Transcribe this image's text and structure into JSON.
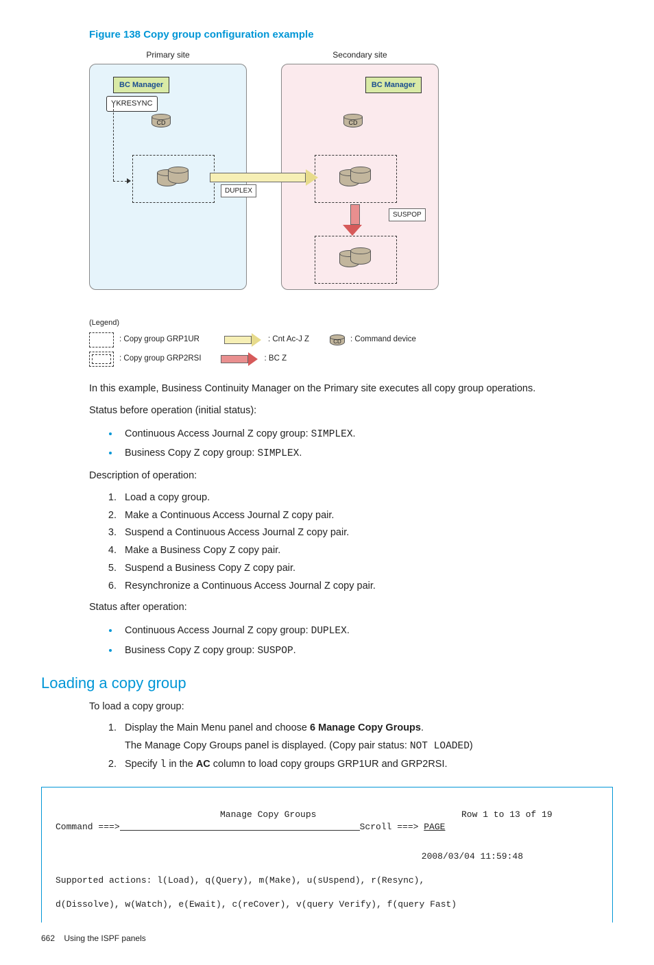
{
  "figure": {
    "title": "Figure 138 Copy group configuration example",
    "primary_label": "Primary site",
    "secondary_label": "Secondary site",
    "bc_manager": "BC Manager",
    "ykresync": "YKRESYNC",
    "cd": "CD",
    "duplex": "DUPLEX",
    "suspop": "SUSPOP",
    "legend_title": "(Legend)",
    "legend_grp1": ": Copy group GRP1UR",
    "legend_grp2": ": Copy group GRP2RSI",
    "legend_cntacj": ": Cnt Ac-J Z",
    "legend_bcz": ": BC Z",
    "legend_cmddev": ": Command device"
  },
  "body": {
    "intro": "In this example, Business Continuity Manager on the Primary site executes all copy group operations.",
    "status_before_label": "Status before operation (initial status):",
    "status_before": [
      {
        "text": "Continuous Access Journal Z copy group: ",
        "code": "SIMPLEX",
        "suffix": "."
      },
      {
        "text": "Business Copy Z copy group: ",
        "code": "SIMPLEX",
        "suffix": "."
      }
    ],
    "desc_label": "Description of operation:",
    "steps": [
      "Load a copy group.",
      "Make a Continuous Access Journal Z copy pair.",
      "Suspend a Continuous Access Journal Z copy pair.",
      "Make a Business Copy Z copy pair.",
      "Suspend a Business Copy Z copy pair.",
      "Resynchronize a Continuous Access Journal Z copy pair."
    ],
    "status_after_label": "Status after operation:",
    "status_after": [
      {
        "text": "Continuous Access Journal Z copy group: ",
        "code": "DUPLEX",
        "suffix": "."
      },
      {
        "text": "Business Copy Z copy group: ",
        "code": "SUSPOP",
        "suffix": "."
      }
    ]
  },
  "section2": {
    "heading": "Loading a copy group",
    "lead": "To load a copy group:",
    "step1_a": "Display the Main Menu panel and choose ",
    "step1_b_bold": "6 Manage Copy Groups",
    "step1_c": ".",
    "step1_sub_a": "The Manage Copy Groups panel is displayed. (Copy pair status: ",
    "step1_sub_code": "NOT LOADED",
    "step1_sub_b": ")",
    "step2_a": "Specify ",
    "step2_code": "l",
    "step2_b": " in the ",
    "step2_bold": "AC",
    "step2_c": " column to load copy groups GRP1UR and GRP2RSI."
  },
  "terminal": {
    "title": "Manage Copy Groups",
    "row_info": "Row 1 to 13 of 19",
    "command_label": "Command ===>",
    "scroll_label": "Scroll ===> ",
    "scroll_value": "PAGE",
    "timestamp": "2008/03/04 11:59:48",
    "actions1": "Supported actions: l(Load), q(Query), m(Make), u(sUspend), r(Resync),",
    "actions2": "d(Dissolve), w(Watch), e(Ewait), c(reCover), v(query Verify), f(query Fast)"
  },
  "footer": {
    "page": "662",
    "title": "Using the ISPF panels"
  }
}
